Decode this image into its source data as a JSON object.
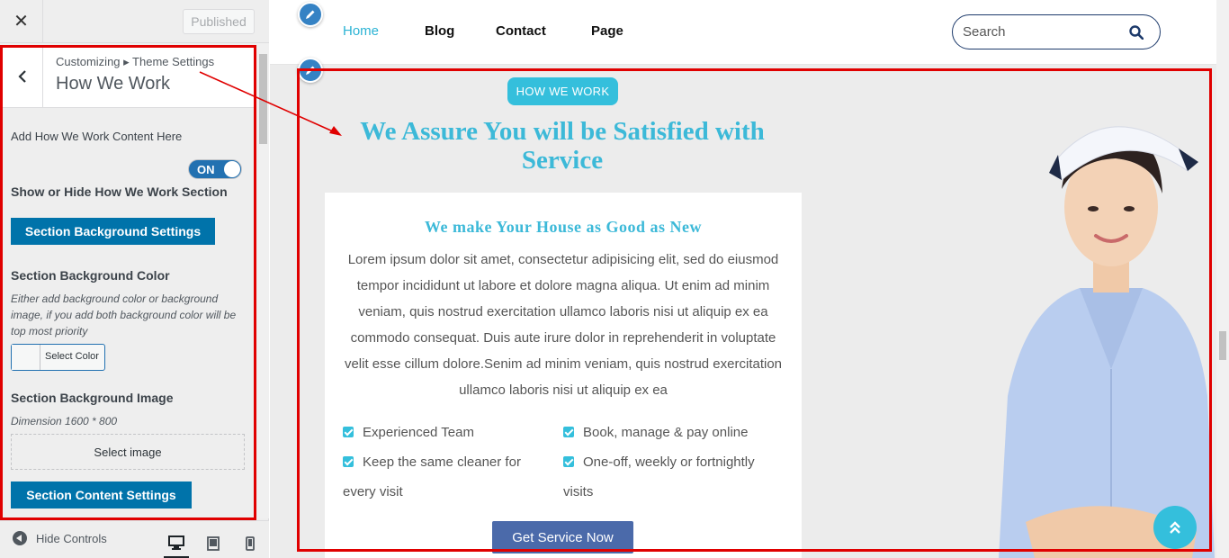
{
  "customizer": {
    "close_symbol": "✕",
    "published_label": "Published",
    "breadcrumb": "Customizing ▸ Theme Settings",
    "panel_title": "How We Work",
    "add_content_label": "Add How We Work Content Here",
    "toggle": {
      "state_label": "ON",
      "value": true
    },
    "show_hide_label": "Show or Hide How We Work Section",
    "bg_settings_button": "Section Background Settings",
    "bg_color_heading": "Section Background Color",
    "bg_color_note": "Either add background color or background image, if you add both background color will be top most priority",
    "select_color_label": "Select Color",
    "bg_image_heading": "Section Background Image",
    "dimension_note": "Dimension 1600 * 800",
    "select_image_label": "Select image",
    "content_settings_button": "Section Content Settings",
    "hide_controls_label": "Hide Controls",
    "devices": [
      "desktop",
      "tablet",
      "mobile"
    ],
    "active_device": "desktop"
  },
  "site": {
    "nav": [
      {
        "label": "Home",
        "active": true
      },
      {
        "label": "Blog",
        "active": false
      },
      {
        "label": "Contact",
        "active": false
      },
      {
        "label": "Page",
        "active": false
      }
    ],
    "search_placeholder": "Search",
    "section": {
      "badge": "HOW WE WORK",
      "title": "We Assure You will be Satisfied with Service",
      "card_title": "We make Your House as Good as New",
      "body": "Lorem ipsum dolor sit amet, consectetur adipisicing elit, sed do eiusmod tempor incididunt ut labore et dolore magna aliqua. Ut enim ad minim veniam, quis nostrud exercitation ullamco laboris nisi ut aliquip ex ea commodo consequat. Duis aute irure dolor in reprehenderit in voluptate velit esse cillum dolore.Senim ad minim veniam, quis nostrud exercitation ullamco laboris nisi ut aliquip ex ea",
      "features": [
        "Experienced Team",
        "Book, manage & pay online",
        "Keep the same cleaner for every visit",
        "One-off, weekly or fortnightly visits"
      ],
      "cta_label": "Get Service Now"
    }
  },
  "colors": {
    "accent": "#34bfdc",
    "title_blue": "#3cb9d8",
    "wp_blue": "#0073aa",
    "cta": "#4b6aaa",
    "highlight_red": "#e00000"
  },
  "icons": [
    "close-icon",
    "back-chevron-icon",
    "search-icon",
    "pencil-icon",
    "checkbox-icon",
    "scroll-top-icon",
    "desktop-icon",
    "tablet-icon",
    "mobile-icon"
  ]
}
